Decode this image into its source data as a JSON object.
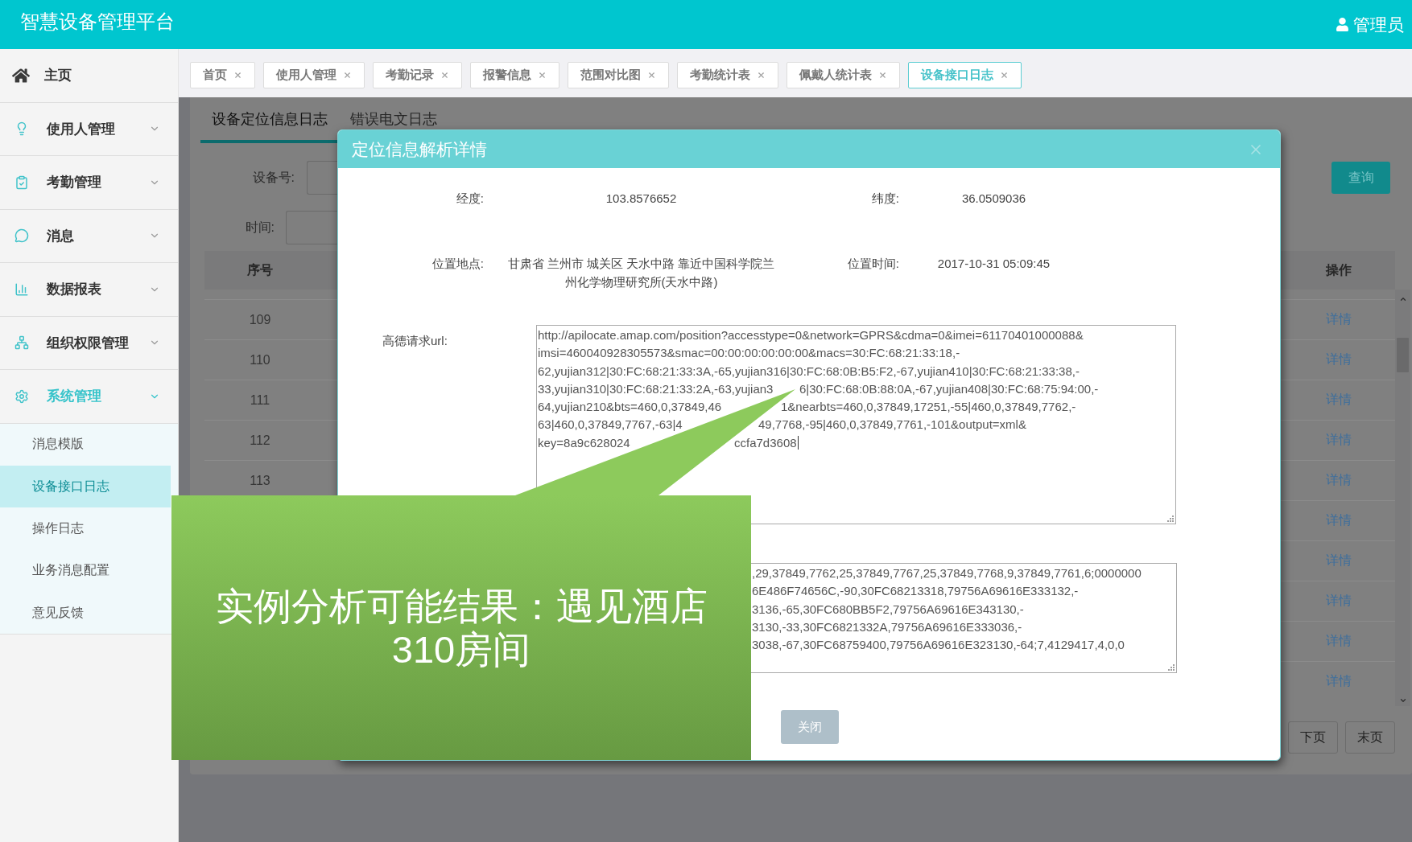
{
  "header": {
    "title": "智慧设备管理平台",
    "user": "管理员"
  },
  "sidebar": {
    "items": [
      {
        "kind": "link",
        "label": "主页",
        "expanded": false
      },
      {
        "kind": "group",
        "label": "使用人管理",
        "expanded": false
      },
      {
        "kind": "group",
        "label": "考勤管理",
        "expanded": false
      },
      {
        "kind": "group",
        "label": "消息",
        "expanded": false
      },
      {
        "kind": "group",
        "label": "数据报表",
        "expanded": false
      },
      {
        "kind": "group",
        "label": "组织权限管理",
        "expanded": false
      },
      {
        "kind": "group",
        "label": "系统管理",
        "expanded": true,
        "children": [
          {
            "label": "消息模版",
            "selected": false
          },
          {
            "label": "设备接口日志",
            "selected": true
          },
          {
            "label": "操作日志",
            "selected": false
          },
          {
            "label": "业务消息配置",
            "selected": false
          },
          {
            "label": "意见反馈",
            "selected": false
          }
        ]
      }
    ]
  },
  "tabs": [
    {
      "label": "首页",
      "selected": false
    },
    {
      "label": "使用人管理",
      "selected": false
    },
    {
      "label": "考勤记录",
      "selected": false
    },
    {
      "label": "报警信息",
      "selected": false
    },
    {
      "label": "范围对比图",
      "selected": false
    },
    {
      "label": "考勤统计表",
      "selected": false
    },
    {
      "label": "佩戴人统计表",
      "selected": false
    },
    {
      "label": "设备接口日志",
      "selected": true
    }
  ],
  "panel": {
    "subtabs": [
      {
        "label": "设备定位信息日志",
        "selected": true
      },
      {
        "label": "错误电文日志",
        "selected": false
      }
    ],
    "filters": [
      {
        "label": "设备号:"
      },
      {
        "label": "时间:"
      }
    ],
    "search_button": "查询",
    "table": {
      "columns": [
        "序号",
        "操作"
      ],
      "rows": [
        {
          "index": "109",
          "action": "详情"
        },
        {
          "index": "110",
          "action": "详情"
        },
        {
          "index": "111",
          "action": "详情"
        },
        {
          "index": "112",
          "action": "详情"
        },
        {
          "index": "113",
          "action": "详情"
        },
        {
          "action": "详情"
        },
        {
          "action": "详情"
        },
        {
          "action": "详情"
        },
        {
          "action": "详情"
        },
        {
          "action": "详情"
        }
      ]
    },
    "pagination": [
      "下页",
      "末页"
    ]
  },
  "modal": {
    "title": "定位信息解析详情",
    "fields": [
      {
        "label": "经度:",
        "value": "103.8576652"
      },
      {
        "label": "纬度:",
        "value": "36.0509036"
      },
      {
        "label": "位置地点:",
        "value": "甘肃省 兰州市 城关区 天水中路 靠近中国科学院兰州化学物理研究所(天水中路)"
      },
      {
        "label": "位置时间:",
        "value": "2017-10-31 05:09:45"
      }
    ],
    "url": {
      "label": "高德请求url:",
      "lines": [
        [
          "http://apilocate.amap.com/position?accesstype=0&network=GPRS&cdma=0&imei=61170401000088&"
        ],
        [
          "imsi=460040928305573&smac=00:00:00:00:00:00&macs=30:FC:68:21:33:18,-"
        ],
        [
          "62,yujian312|30:FC:68:21:33:3A,-65,yujian316|30:FC:68:0B:B5:F2,-67,yujian410|30:FC:68:21:33:38,-"
        ],
        [
          "33,yujian310|30:FC:68:21:33:2A,-63,yujian3",
          "6|30:FC:68:0B:88:0A,-67,yujian408|30:FC:68:75:94:00,-"
        ],
        [
          "64,yujian210&bts=460,0,37849,46",
          "1&nearbts=460,0,37849,17251,-55|460,0,37849,7762,-"
        ],
        [
          "63|460,0,37849,7767,-63|4",
          "49,7768,-95|460,0,37849,7761,-101&output=xml&"
        ],
        [
          "key=8a9c628024",
          "ccfa7d3608"
        ]
      ]
    },
    "response": {
      "lines": [
        ",29,37849,7762,25,37849,7767,25,37849,7768,9,37849,7761,6;0000000",
        "6E486F74656C,-90,30FC68213318,79756A69616E333132,-",
        "3136,-65,30FC680BB5F2,79756A69616E343130,-",
        "3130,-33,30FC6821332A,79756A69616E333036,-",
        "3038,-67,30FC68759400,79756A69616E323130,-64;7,4129417,4,0,0"
      ]
    },
    "close_button": "关闭"
  },
  "callout": {
    "text": "实例分析可能结果：遇见酒店310房间"
  }
}
